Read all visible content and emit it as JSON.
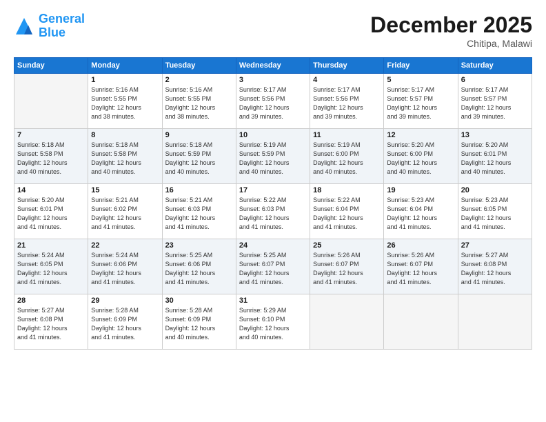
{
  "logo": {
    "line1": "General",
    "line2": "Blue"
  },
  "title": "December 2025",
  "location": "Chitipa, Malawi",
  "days_of_week": [
    "Sunday",
    "Monday",
    "Tuesday",
    "Wednesday",
    "Thursday",
    "Friday",
    "Saturday"
  ],
  "weeks": [
    [
      {
        "num": "",
        "info": ""
      },
      {
        "num": "1",
        "info": "Sunrise: 5:16 AM\nSunset: 5:55 PM\nDaylight: 12 hours\nand 38 minutes."
      },
      {
        "num": "2",
        "info": "Sunrise: 5:16 AM\nSunset: 5:55 PM\nDaylight: 12 hours\nand 38 minutes."
      },
      {
        "num": "3",
        "info": "Sunrise: 5:17 AM\nSunset: 5:56 PM\nDaylight: 12 hours\nand 39 minutes."
      },
      {
        "num": "4",
        "info": "Sunrise: 5:17 AM\nSunset: 5:56 PM\nDaylight: 12 hours\nand 39 minutes."
      },
      {
        "num": "5",
        "info": "Sunrise: 5:17 AM\nSunset: 5:57 PM\nDaylight: 12 hours\nand 39 minutes."
      },
      {
        "num": "6",
        "info": "Sunrise: 5:17 AM\nSunset: 5:57 PM\nDaylight: 12 hours\nand 39 minutes."
      }
    ],
    [
      {
        "num": "7",
        "info": "Sunrise: 5:18 AM\nSunset: 5:58 PM\nDaylight: 12 hours\nand 40 minutes."
      },
      {
        "num": "8",
        "info": "Sunrise: 5:18 AM\nSunset: 5:58 PM\nDaylight: 12 hours\nand 40 minutes."
      },
      {
        "num": "9",
        "info": "Sunrise: 5:18 AM\nSunset: 5:59 PM\nDaylight: 12 hours\nand 40 minutes."
      },
      {
        "num": "10",
        "info": "Sunrise: 5:19 AM\nSunset: 5:59 PM\nDaylight: 12 hours\nand 40 minutes."
      },
      {
        "num": "11",
        "info": "Sunrise: 5:19 AM\nSunset: 6:00 PM\nDaylight: 12 hours\nand 40 minutes."
      },
      {
        "num": "12",
        "info": "Sunrise: 5:20 AM\nSunset: 6:00 PM\nDaylight: 12 hours\nand 40 minutes."
      },
      {
        "num": "13",
        "info": "Sunrise: 5:20 AM\nSunset: 6:01 PM\nDaylight: 12 hours\nand 40 minutes."
      }
    ],
    [
      {
        "num": "14",
        "info": "Sunrise: 5:20 AM\nSunset: 6:01 PM\nDaylight: 12 hours\nand 41 minutes."
      },
      {
        "num": "15",
        "info": "Sunrise: 5:21 AM\nSunset: 6:02 PM\nDaylight: 12 hours\nand 41 minutes."
      },
      {
        "num": "16",
        "info": "Sunrise: 5:21 AM\nSunset: 6:03 PM\nDaylight: 12 hours\nand 41 minutes."
      },
      {
        "num": "17",
        "info": "Sunrise: 5:22 AM\nSunset: 6:03 PM\nDaylight: 12 hours\nand 41 minutes."
      },
      {
        "num": "18",
        "info": "Sunrise: 5:22 AM\nSunset: 6:04 PM\nDaylight: 12 hours\nand 41 minutes."
      },
      {
        "num": "19",
        "info": "Sunrise: 5:23 AM\nSunset: 6:04 PM\nDaylight: 12 hours\nand 41 minutes."
      },
      {
        "num": "20",
        "info": "Sunrise: 5:23 AM\nSunset: 6:05 PM\nDaylight: 12 hours\nand 41 minutes."
      }
    ],
    [
      {
        "num": "21",
        "info": "Sunrise: 5:24 AM\nSunset: 6:05 PM\nDaylight: 12 hours\nand 41 minutes."
      },
      {
        "num": "22",
        "info": "Sunrise: 5:24 AM\nSunset: 6:06 PM\nDaylight: 12 hours\nand 41 minutes."
      },
      {
        "num": "23",
        "info": "Sunrise: 5:25 AM\nSunset: 6:06 PM\nDaylight: 12 hours\nand 41 minutes."
      },
      {
        "num": "24",
        "info": "Sunrise: 5:25 AM\nSunset: 6:07 PM\nDaylight: 12 hours\nand 41 minutes."
      },
      {
        "num": "25",
        "info": "Sunrise: 5:26 AM\nSunset: 6:07 PM\nDaylight: 12 hours\nand 41 minutes."
      },
      {
        "num": "26",
        "info": "Sunrise: 5:26 AM\nSunset: 6:07 PM\nDaylight: 12 hours\nand 41 minutes."
      },
      {
        "num": "27",
        "info": "Sunrise: 5:27 AM\nSunset: 6:08 PM\nDaylight: 12 hours\nand 41 minutes."
      }
    ],
    [
      {
        "num": "28",
        "info": "Sunrise: 5:27 AM\nSunset: 6:08 PM\nDaylight: 12 hours\nand 41 minutes."
      },
      {
        "num": "29",
        "info": "Sunrise: 5:28 AM\nSunset: 6:09 PM\nDaylight: 12 hours\nand 41 minutes."
      },
      {
        "num": "30",
        "info": "Sunrise: 5:28 AM\nSunset: 6:09 PM\nDaylight: 12 hours\nand 40 minutes."
      },
      {
        "num": "31",
        "info": "Sunrise: 5:29 AM\nSunset: 6:10 PM\nDaylight: 12 hours\nand 40 minutes."
      },
      {
        "num": "",
        "info": ""
      },
      {
        "num": "",
        "info": ""
      },
      {
        "num": "",
        "info": ""
      }
    ]
  ]
}
